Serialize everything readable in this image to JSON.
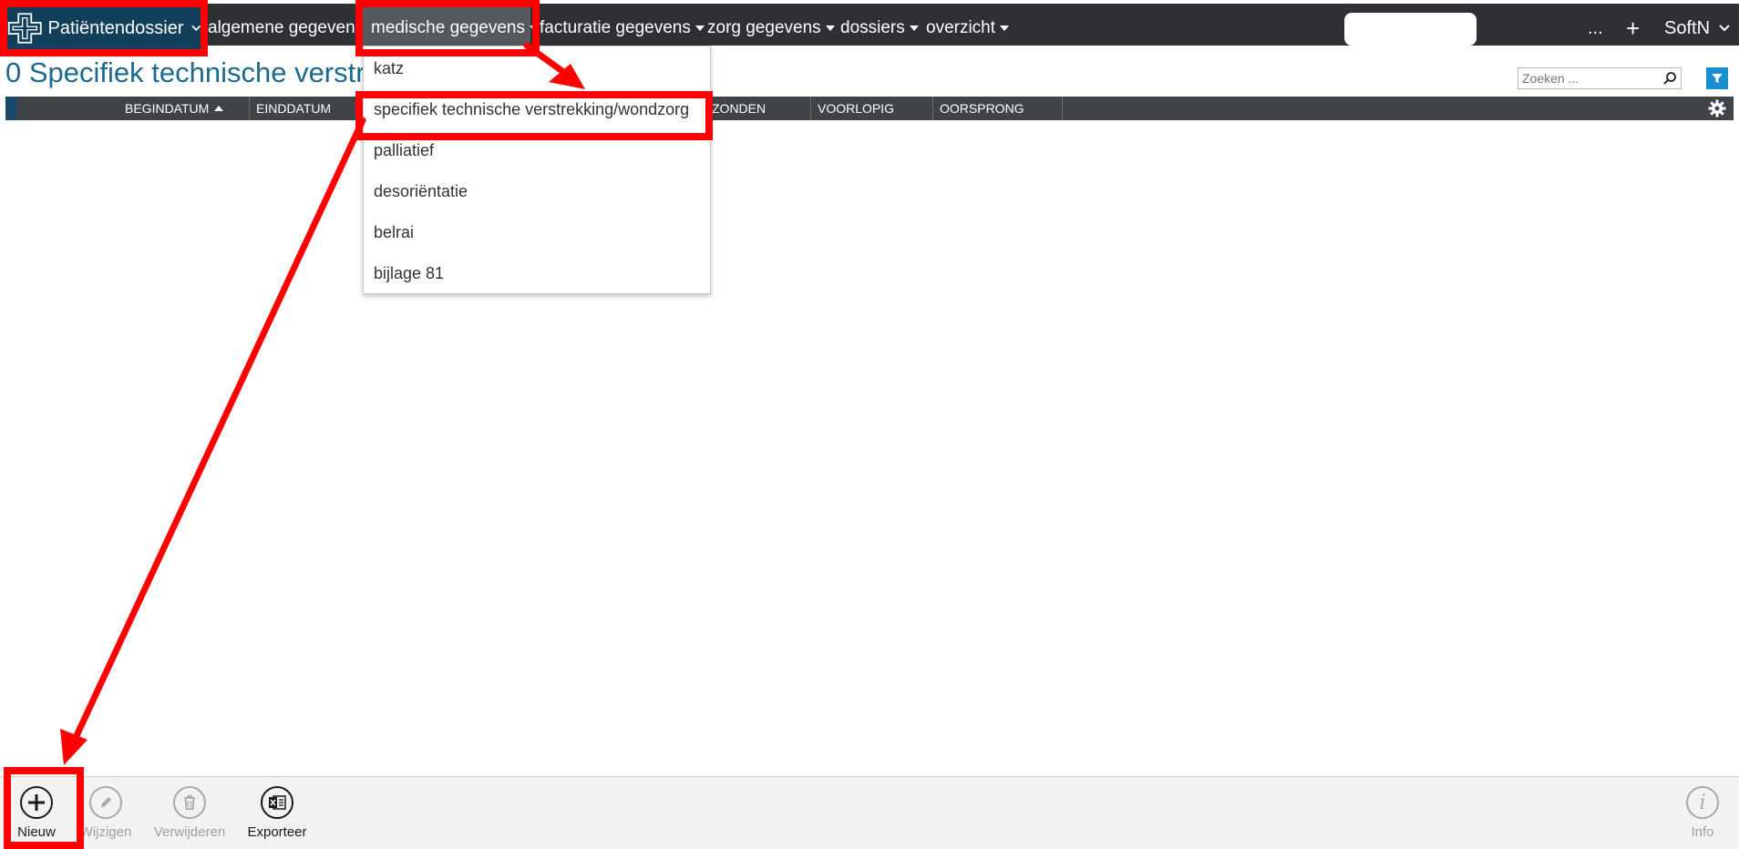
{
  "topbar": {
    "brand_label": "Patiëntendossier",
    "menus": [
      {
        "label": "algemene gegevens",
        "has_caret": false
      },
      {
        "label": "medische gegevens",
        "has_caret": true,
        "active": true
      },
      {
        "label": "facturatie gegevens",
        "has_caret": true
      },
      {
        "label": "zorg gegevens",
        "has_caret": true
      },
      {
        "label": "dossiers",
        "has_caret": true
      },
      {
        "label": "overzicht",
        "has_caret": true
      }
    ],
    "more_label": "...",
    "add_label": "+",
    "user_label": "SoftN"
  },
  "page": {
    "title": "0 Specifiek technische verstr",
    "search_placeholder": "Zoeken ..."
  },
  "grid": {
    "columns": [
      "BEGINDATUM",
      "EINDDATUM",
      "",
      "ZONDEN",
      "VOORLOPIG",
      "OORSPRONG"
    ],
    "sorted_column": "BEGINDATUM",
    "sort_direction": "asc"
  },
  "dropdown": {
    "items": [
      "katz",
      "specifiek technische verstrekking/wondzorg",
      "palliatief",
      "desoriëntatie",
      "belrai",
      "bijlage 81"
    ]
  },
  "footer": {
    "tools": [
      {
        "label": "Nieuw",
        "icon": "plus-icon",
        "enabled": true
      },
      {
        "label": "Wijzigen",
        "icon": "pencil-icon",
        "enabled": false
      },
      {
        "label": "Verwijderen",
        "icon": "trash-icon",
        "enabled": false
      },
      {
        "label": "Exporteer",
        "icon": "excel-icon",
        "enabled": true
      }
    ],
    "info_label": "Info"
  },
  "colors": {
    "topbar": "#2e3033",
    "brand": "#12405b",
    "title": "#1d6a8f",
    "annotation": "#ff0000",
    "filter": "#1a8fd0"
  }
}
